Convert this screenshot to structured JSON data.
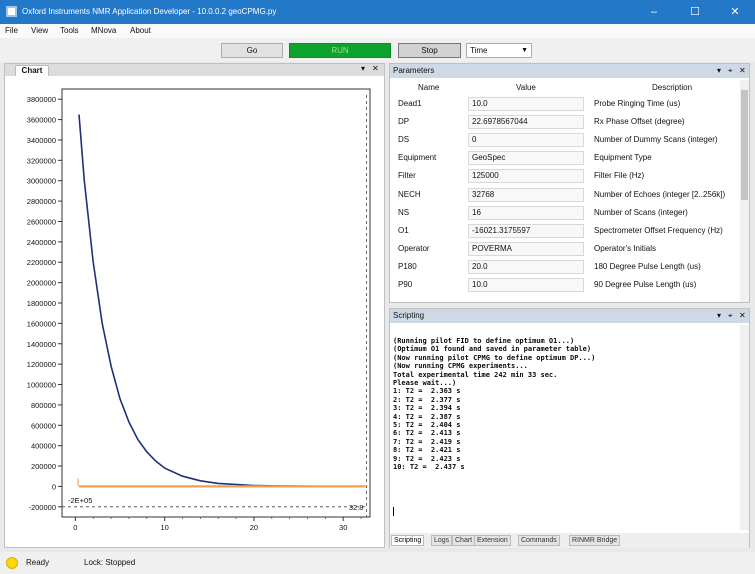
{
  "window": {
    "title": "Oxford Instruments NMR Application Developer - 10.0.0.2 geoCPMG.py"
  },
  "menu": [
    "File",
    "View",
    "Tools",
    "MNova",
    "About"
  ],
  "toolbar": {
    "go_label": "Go",
    "run_label": "RUN",
    "stop_label": "Stop",
    "time_select": "Time"
  },
  "chart_pane": {
    "tab_label": "Chart"
  },
  "chart_data": {
    "type": "line",
    "xlabel": "",
    "ylabel": "",
    "xlim": [
      -1.5,
      33
    ],
    "ylim": [
      -300000,
      3900000
    ],
    "x_ticks": [
      "0",
      "10",
      "20",
      "30"
    ],
    "y_ticks": [
      "3800000",
      "3600000",
      "3400000",
      "3200000",
      "3000000",
      "2800000",
      "2600000",
      "2400000",
      "2200000",
      "2000000",
      "1800000",
      "1600000",
      "1400000",
      "1200000",
      "1000000",
      "800000",
      "600000",
      "400000",
      "200000",
      "0",
      "-200000"
    ],
    "annotations": [
      "-2E+05",
      "32.8"
    ],
    "series": [
      {
        "color": "#1f2f7a",
        "x": [
          0.4,
          1,
          2,
          3,
          4,
          5,
          6,
          7,
          8,
          9,
          10,
          12,
          14,
          16,
          20,
          25,
          30,
          32.5
        ],
        "values": [
          3650000,
          3000000,
          2200000,
          1600000,
          1180000,
          860000,
          630000,
          460000,
          340000,
          250000,
          180000,
          100000,
          55000,
          30000,
          9000,
          2000,
          500,
          200
        ]
      },
      {
        "color": "#f0a050",
        "x": [
          0.4,
          32.5
        ],
        "values": [
          0,
          0
        ]
      }
    ]
  },
  "parameters": {
    "title": "Parameters",
    "col_name": "Name",
    "col_value": "Value",
    "col_desc": "Description",
    "rows": [
      {
        "name": "Dead1",
        "value": "10.0",
        "desc": "Probe Ringing Time (us)"
      },
      {
        "name": "DP",
        "value": "22.6978567044",
        "desc": "Rx Phase Offset (degree)"
      },
      {
        "name": "DS",
        "value": "0",
        "desc": "Number of Dummy Scans (integer)"
      },
      {
        "name": "Equipment",
        "value": "GeoSpec",
        "desc": "Equipment Type"
      },
      {
        "name": "Filter",
        "value": "125000",
        "desc": "Filter File (Hz)"
      },
      {
        "name": "NECH",
        "value": "32768",
        "desc": "Number of Echoes (integer [2..256k])"
      },
      {
        "name": "NS",
        "value": "16",
        "desc": "Number of Scans (integer)"
      },
      {
        "name": "O1",
        "value": "-16021.3175597",
        "desc": "Spectrometer Offset Frequency (Hz)"
      },
      {
        "name": "Operator",
        "value": "POVERMA",
        "desc": "Operator's Initials"
      },
      {
        "name": "P180",
        "value": "20.0",
        "desc": "180 Degree Pulse Length (us)"
      },
      {
        "name": "P90",
        "value": "10.0",
        "desc": "90 Degree Pulse Length (us)"
      }
    ]
  },
  "scripting": {
    "title": "Scripting",
    "lines": [
      "(Running pilot FID to define optimum O1...)",
      "(Optimum O1 found and saved in parameter table)",
      "(Now running pilot CPMG to define optimum DP...)",
      "(Now running CPMG experiments...",
      "Total experimental time 242 min 33 sec.",
      "Please wait...)",
      "1: T2 =  2.363 s",
      "2: T2 =  2.377 s",
      "3: T2 =  2.394 s",
      "4: T2 =  2.387 s",
      "5: T2 =  2.404 s",
      "6: T2 =  2.413 s",
      "7: T2 =  2.419 s",
      "8: T2 =  2.421 s",
      "9: T2 =  2.423 s",
      "10: T2 =  2.437 s"
    ],
    "tabs": [
      "Scripting",
      "Logs",
      "Chart",
      "Extension",
      "Commands",
      "RINMR Bridge"
    ]
  },
  "status": {
    "state": "Ready",
    "lock": "Lock: Stopped",
    "indicator_color": "#ffd800"
  }
}
